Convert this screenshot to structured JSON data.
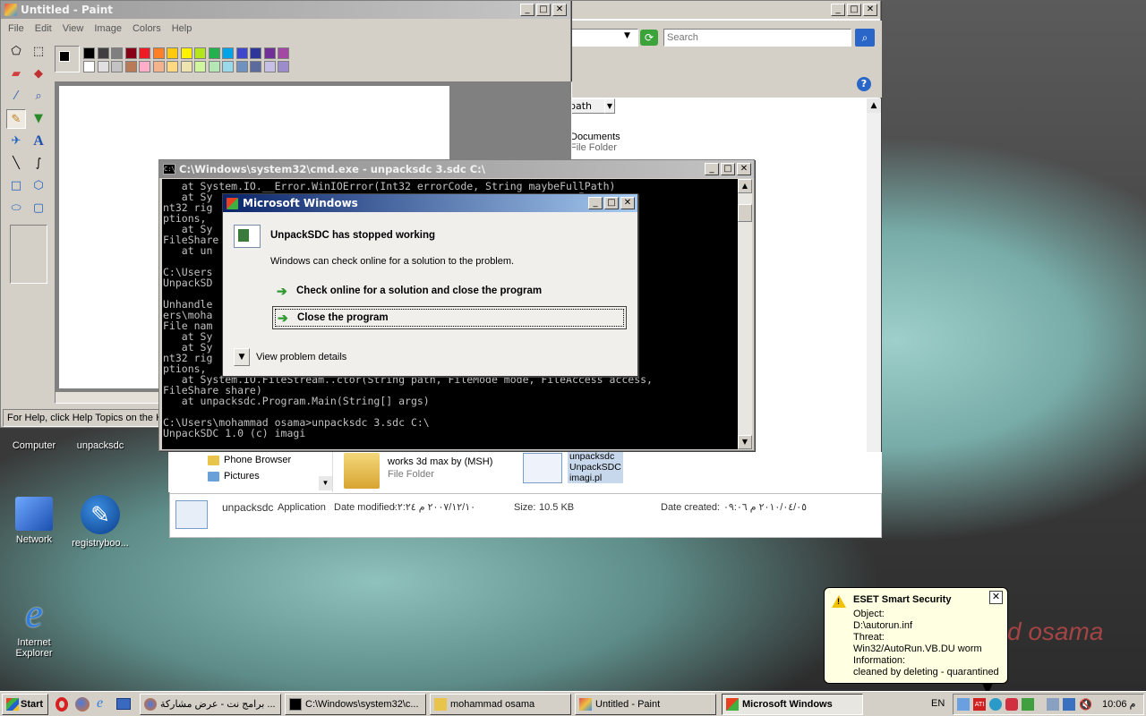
{
  "paint": {
    "title": "Untitled - Paint",
    "menu": [
      "File",
      "Edit",
      "View",
      "Image",
      "Colors",
      "Help"
    ],
    "status": "For Help, click Help Topics on the Help Menu.",
    "colors_top": [
      "#000000",
      "#808080",
      "#800000",
      "#808000",
      "#008000",
      "#008080",
      "#000080",
      "#800080",
      "#808040",
      "#004040",
      "#0080ff",
      "#004080",
      "#8000ff",
      "#804000",
      "#ff0000",
      "#ff8000"
    ],
    "palette_row1": [
      "#000000",
      "#404040",
      "#7f7f7f",
      "#880015",
      "#ed1c24",
      "#ff7f27",
      "#ffc90e",
      "#fff200",
      "#b5e61d",
      "#22b14c",
      "#00a2e8",
      "#3f48cc",
      "#2f3699",
      "#6f3198",
      "#a349a4"
    ],
    "palette_row2": [
      "#ffffff",
      "#e0e0e0",
      "#c3c3c3",
      "#b97a57",
      "#ffaec9",
      "#f5b38d",
      "#ffd87f",
      "#efe4b0",
      "#d2f5a0",
      "#b5e6b5",
      "#99d9ea",
      "#7092be",
      "#5b6b9e",
      "#c8bfe7",
      "#9c8ccc"
    ]
  },
  "explorer": {
    "search_placeholder": "Search",
    "column_header": "path",
    "items": [
      {
        "name": "Documents",
        "type": "File Folder"
      },
      {
        "name": "works 3d max by (MSH)",
        "type": "File Folder"
      }
    ],
    "file_tile": [
      "unpacksdc",
      "UnpackSDC",
      "imagi.pl"
    ],
    "nav": [
      "Phone Browser",
      "Pictures"
    ],
    "details": {
      "name": "unpacksdc",
      "kind": "Application",
      "modified_label": "Date modified:",
      "modified": "٢٠٠٧/١٢/١٠ م ٠٢:٢٤",
      "size_label": "Size:",
      "size": "10.5 KB",
      "created_label": "Date created:",
      "created": "٢٠١٠/٠٤/٠٥ م ٠٩:٠٦"
    }
  },
  "cmd": {
    "title": "C:\\Windows\\system32\\cmd.exe - unpacksdc  3.sdc C:\\",
    "lines": [
      "   at System.IO.__Error.WinIOError(Int32 errorCode, String maybeFullPath)",
      "   at Sy                                              cess access, I",
      "nt32 rig                                              FileOptions o",
      "ptions,                                               nProxy)",
      "   at Sy                                              cess access,",
      "FileShare",
      "   at un",
      "",
      "C:\\Users",
      "UnpackSD",
      "",
      "Unhandle                                              nd file 'C:\\Us",
      "ers\\moha",
      "File nam",
      "   at Sy                                              ullPath)",
      "   at Sy                                              cess access, I",
      "nt32 rig                                              FileOptions o",
      "ptions,                                              nProxy)",
      "   at System.IO.FileStream..ctor(String path, FileMode mode, FileAccess access,",
      "FileShare share)",
      "   at unpacksdc.Program.Main(String[] args)",
      "",
      "C:\\Users\\mohammad osama>unpacksdc 3.sdc C:\\",
      "UnpackSDC 1.0 (c) imagi"
    ]
  },
  "dialog": {
    "title": "Microsoft Windows",
    "heading": "UnpackSDC has stopped working",
    "message": "Windows can check online for a solution to the problem.",
    "option1": "Check online for a solution and close the program",
    "option2": "Close the program",
    "details": "View problem details"
  },
  "desktop": {
    "icons": [
      {
        "label": "Computer"
      },
      {
        "label": "unpacksdc"
      },
      {
        "label": "Network"
      },
      {
        "label": "registryboo..."
      },
      {
        "label": "Internet Explorer"
      }
    ],
    "wallpaper_text": "d osama"
  },
  "eset": {
    "title": "ESET Smart Security",
    "lines": [
      "Object:",
      "D:\\autorun.inf",
      "Threat:",
      "Win32/AutoRun.VB.DU worm",
      "Information:",
      "cleaned by deleting - quarantined"
    ]
  },
  "taskbar": {
    "start": "Start",
    "tasks": [
      {
        "label": "برامج نت - عرض مشاركة ...",
        "active": false
      },
      {
        "label": "C:\\Windows\\system32\\c...",
        "active": false
      },
      {
        "label": "mohammad osama",
        "active": false
      },
      {
        "label": "Untitled - Paint",
        "active": false
      },
      {
        "label": "Microsoft Windows",
        "active": true
      }
    ],
    "lang": "EN",
    "clock": "10:06 م"
  },
  "colors": {
    "accent": "#0a246a",
    "taskbar": "#d4d0c8",
    "green_arrow": "#2f9a2f"
  }
}
